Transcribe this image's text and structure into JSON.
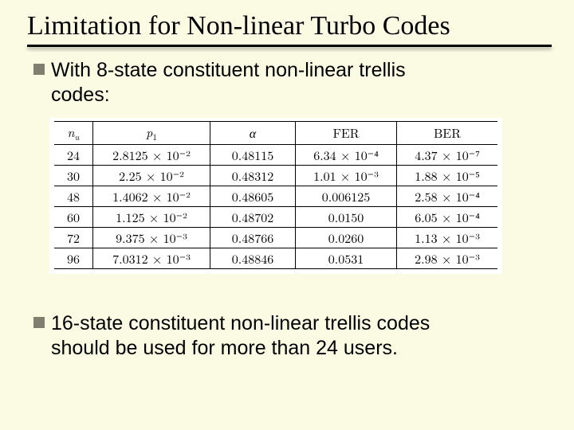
{
  "title": "Limitation for Non-linear Turbo Codes",
  "bullet1_line1": "With 8-state constituent non-linear trellis",
  "bullet1_line2": "codes:",
  "bullet2_line1": "16-state constituent non-linear trellis codes",
  "bullet2_line2": "should be used for more than 24 users.",
  "table": {
    "headers": {
      "nu": "n",
      "nu_sub": "u",
      "p1": "p",
      "p1_sub": "1",
      "alpha": "α",
      "fer": "FER",
      "ber": "BER"
    },
    "rows": [
      {
        "nu": "24",
        "p1": "2.8125 × 10⁻²",
        "alpha": "0.48115",
        "fer": "6.34 × 10⁻⁴",
        "ber": "4.37 × 10⁻⁷"
      },
      {
        "nu": "30",
        "p1": "2.25 × 10⁻²",
        "alpha": "0.48312",
        "fer": "1.01 × 10⁻³",
        "ber": "1.88 × 10⁻⁵"
      },
      {
        "nu": "48",
        "p1": "1.4062 × 10⁻²",
        "alpha": "0.48605",
        "fer": "0.006125",
        "ber": "2.58 × 10⁻⁴"
      },
      {
        "nu": "60",
        "p1": "1.125 × 10⁻²",
        "alpha": "0.48702",
        "fer": "0.0150",
        "ber": "6.05 × 10⁻⁴"
      },
      {
        "nu": "72",
        "p1": "9.375 × 10⁻³",
        "alpha": "0.48766",
        "fer": "0.0260",
        "ber": "1.13 × 10⁻³"
      },
      {
        "nu": "96",
        "p1": "7.0312 × 10⁻³",
        "alpha": "0.48846",
        "fer": "0.0531",
        "ber": "2.98 × 10⁻³"
      }
    ]
  },
  "chart_data": {
    "type": "table",
    "title": "Limitation for Non-linear Turbo Codes — 8-state constituent non-linear trellis codes",
    "columns": [
      "n_u",
      "p1",
      "alpha",
      "FER",
      "BER"
    ],
    "rows": [
      [
        24,
        0.028125,
        0.48115,
        0.000634,
        4.37e-07
      ],
      [
        30,
        0.0225,
        0.48312,
        0.00101,
        1.88e-05
      ],
      [
        48,
        0.014062,
        0.48605,
        0.006125,
        0.000258
      ],
      [
        60,
        0.01125,
        0.48702,
        0.015,
        0.000605
      ],
      [
        72,
        0.009375,
        0.48766,
        0.026,
        0.00113
      ],
      [
        96,
        0.0070312,
        0.48846,
        0.0531,
        0.00298
      ]
    ]
  }
}
